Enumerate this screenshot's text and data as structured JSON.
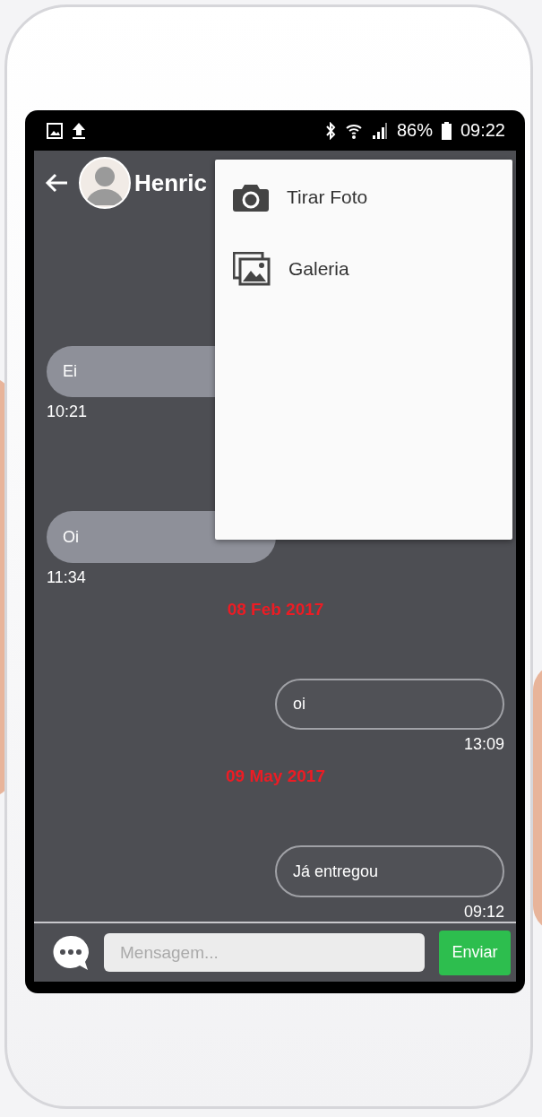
{
  "status_bar": {
    "battery": "86%",
    "time": "09:22"
  },
  "header": {
    "contact_name": "Henric"
  },
  "attach_menu": {
    "items": [
      {
        "kind": "camera",
        "label": "Tirar Foto"
      },
      {
        "kind": "gallery",
        "label": "Galeria"
      }
    ]
  },
  "messages": [
    {
      "kind": "received",
      "text": "Ei",
      "time": "10:21"
    },
    {
      "kind": "received",
      "text": "Oi",
      "time": "11:34"
    },
    {
      "kind": "date",
      "text": "08 Feb 2017"
    },
    {
      "kind": "sent",
      "text": "oi",
      "time": "13:09"
    },
    {
      "kind": "date",
      "text": "09 May 2017"
    },
    {
      "kind": "sent",
      "text": "Já entregou",
      "time": "09:12"
    }
  ],
  "composer": {
    "placeholder": "Mensagem...",
    "send_button": "Enviar"
  }
}
